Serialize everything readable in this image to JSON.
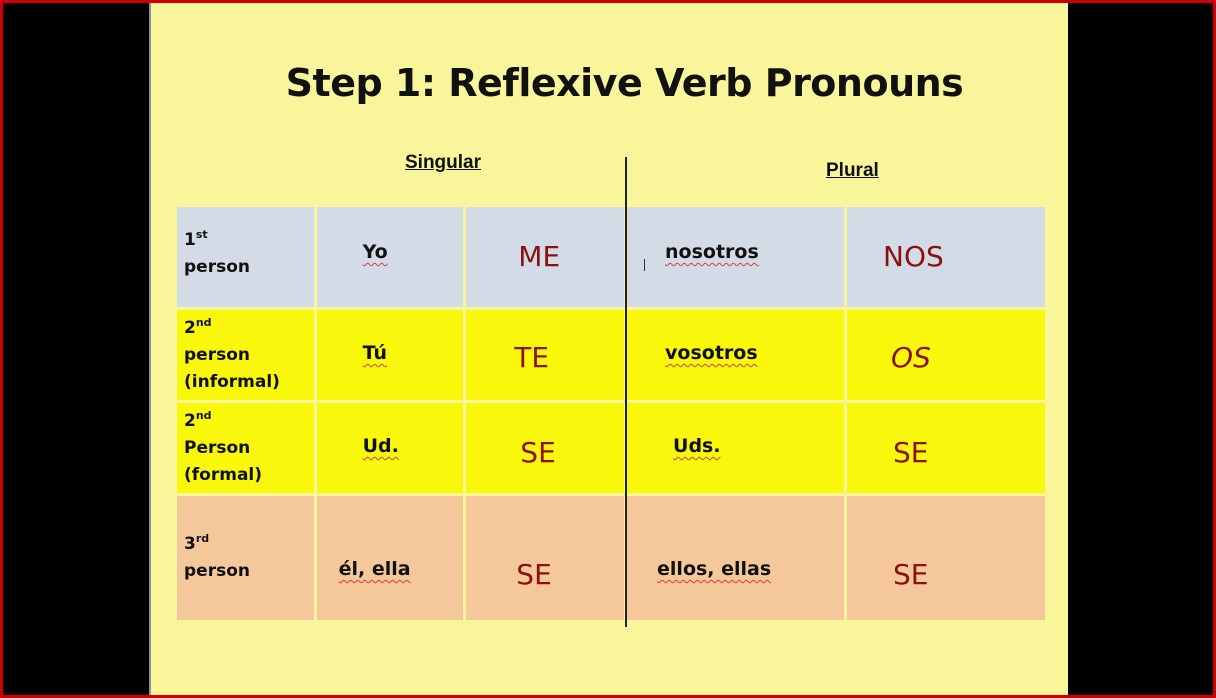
{
  "slide": {
    "title": "Step 1:  Reflexive Verb Pronouns",
    "headers": {
      "singular": "Singular",
      "plural": "Plural"
    },
    "colors": {
      "background": "#f8f59a",
      "row_first_person": "#d3dbe6",
      "row_second_person": "#f8f70c",
      "row_third_person": "#f5c89b",
      "pronoun_text": "#8b1010",
      "frame": "#d00000"
    },
    "rows": [
      {
        "ordinal": "1",
        "suffix": "st",
        "label_lines": [
          "person"
        ],
        "singular_subject": "Yo",
        "singular_pronoun": "ME",
        "plural_subject": "nosotros",
        "plural_pronoun": "NOS"
      },
      {
        "ordinal": "2",
        "suffix": "nd",
        "label_lines": [
          "person",
          "(informal)"
        ],
        "singular_subject": "Tú",
        "singular_pronoun": "TE",
        "plural_subject": "vosotros",
        "plural_pronoun": "OS"
      },
      {
        "ordinal": "2",
        "suffix": "nd",
        "label_lines": [
          "Person",
          "(formal)"
        ],
        "singular_subject": "Ud.",
        "singular_pronoun": "SE",
        "plural_subject": "Uds.",
        "plural_pronoun": "SE"
      },
      {
        "ordinal": "3",
        "suffix": "rd",
        "label_lines": [
          "person"
        ],
        "singular_subject": "él, ella",
        "singular_pronoun": "SE",
        "plural_subject": "ellos, ellas",
        "plural_pronoun": "SE"
      }
    ]
  }
}
